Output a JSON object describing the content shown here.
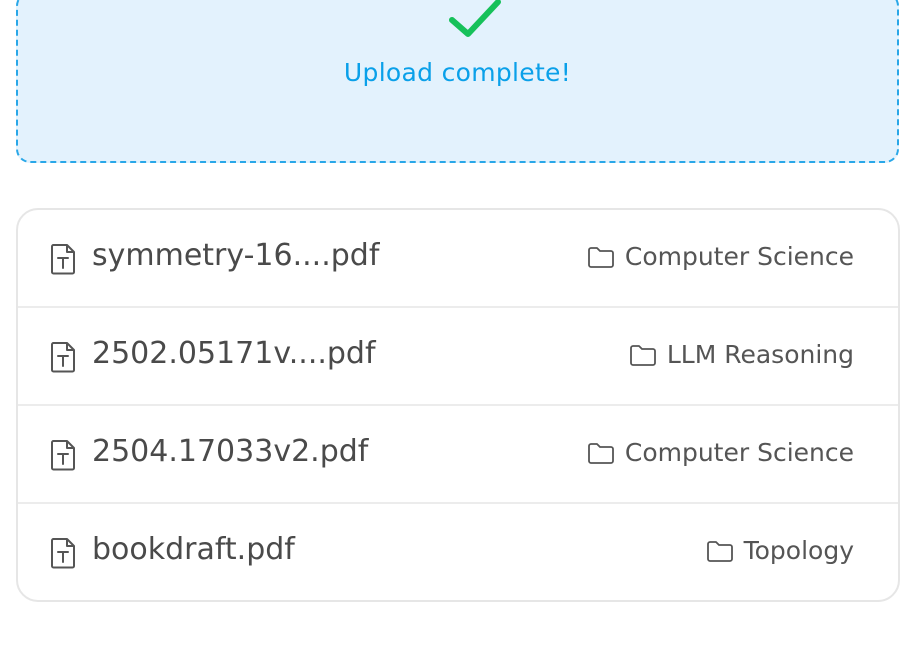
{
  "upload": {
    "status_text": "Upload complete!",
    "icon": "check-icon",
    "accent_color": "#0aa0e9",
    "check_color": "#16c15a"
  },
  "files": [
    {
      "name": "symmetry-16....pdf",
      "folder": "Computer Science",
      "icon": "file-text-icon",
      "folder_icon": "folder-icon"
    },
    {
      "name": "2502.05171v....pdf",
      "folder": "LLM Reasoning",
      "icon": "file-text-icon",
      "folder_icon": "folder-icon"
    },
    {
      "name": "2504.17033v2.pdf",
      "folder": "Computer Science",
      "icon": "file-text-icon",
      "folder_icon": "folder-icon"
    },
    {
      "name": "bookdraft.pdf",
      "folder": "Topology",
      "icon": "file-text-icon",
      "folder_icon": "folder-icon"
    }
  ]
}
